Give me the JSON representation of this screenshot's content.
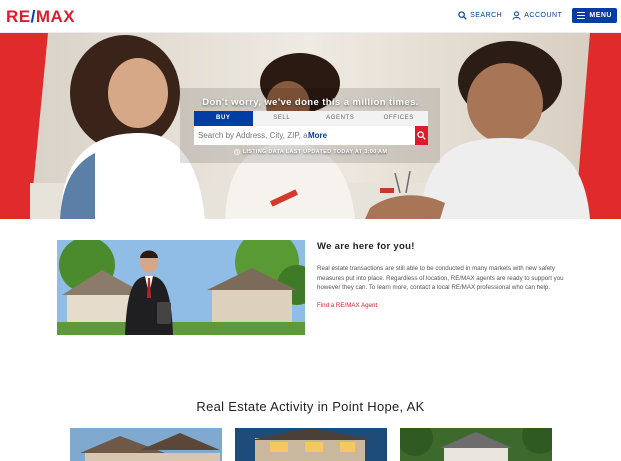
{
  "brand": {
    "name_left": "RE",
    "name_slash": "/",
    "name_right": "MAX"
  },
  "nav": {
    "search_label": "SEARCH",
    "account_label": "ACCOUNT",
    "menu_label": "MENU"
  },
  "hero": {
    "tagline": "Don't worry, we've done this a million times.",
    "tabs": [
      {
        "label": "BUY",
        "active": true
      },
      {
        "label": "SELL",
        "active": false
      },
      {
        "label": "AGENTS",
        "active": false
      },
      {
        "label": "OFFICES",
        "active": false
      }
    ],
    "search_placeholder": "Search by Address, City, ZIP, and ",
    "more_label": "More",
    "updated_text": "LISTING DATA LAST UPDATED TODAY AT 3:00 AM"
  },
  "here_for_you": {
    "title": "We are here for you!",
    "body": "Real estate transactions are still able to be conducted in many markets with new safety measures put into place. Regardless of location, RE/MAX agents are ready to support you however they can. To learn more, contact a local RE/MAX professional who can help.",
    "link_label": "Find a RE/MAX Agent"
  },
  "activity": {
    "title": "Real Estate Activity in Point Hope, AK"
  },
  "colors": {
    "brand_red": "#dc1c2e",
    "brand_blue": "#003da5"
  }
}
